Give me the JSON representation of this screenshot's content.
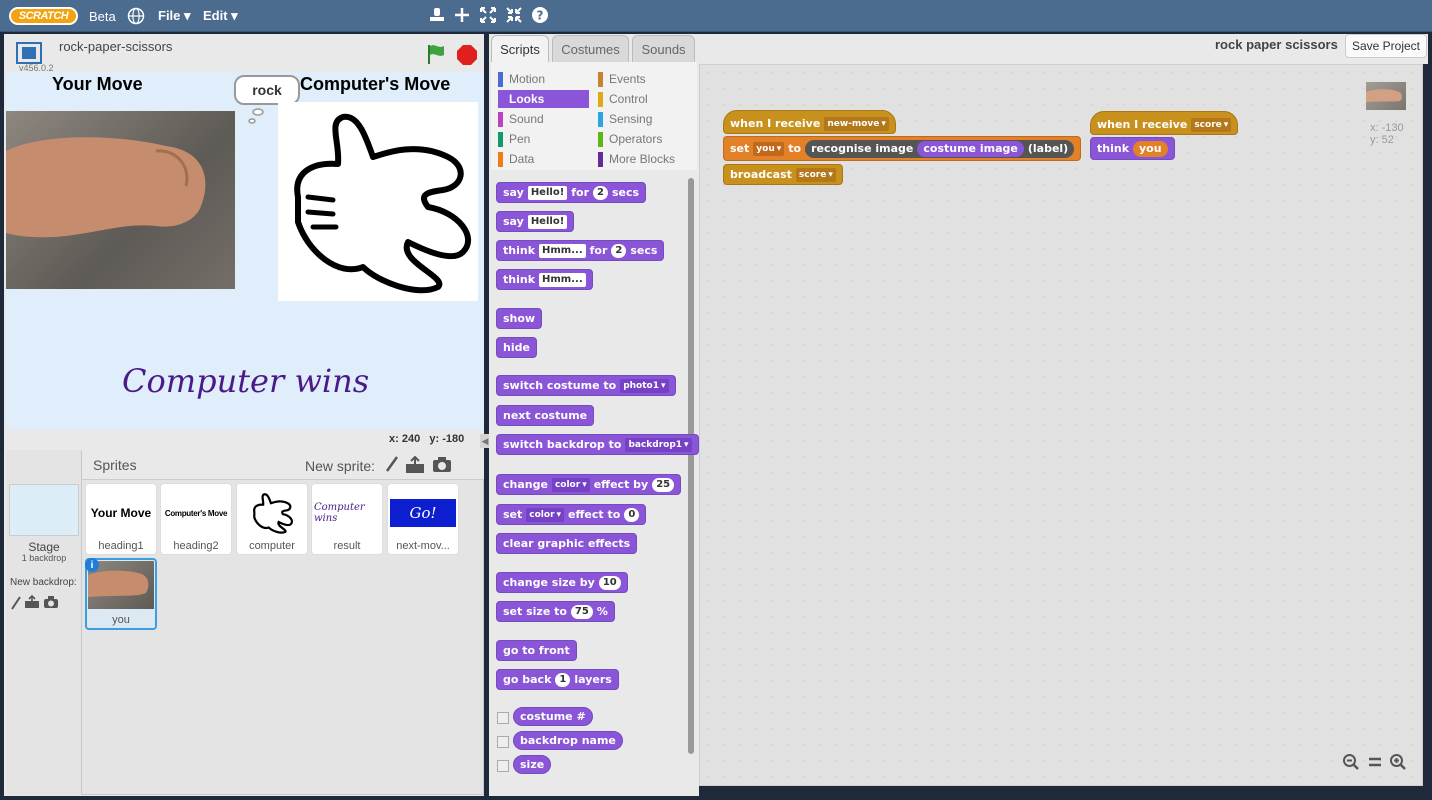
{
  "menubar": {
    "logo": "SCRATCH",
    "beta": "Beta",
    "file": "File",
    "edit": "Edit"
  },
  "project": {
    "name": "rock-paper-scissors",
    "version": "v456.0.2",
    "title": "rock paper scissors",
    "save": "Save Project"
  },
  "stage": {
    "your_move": "Your Move",
    "computers_move": "Computer's Move",
    "bubble": "rock",
    "result": "Computer wins",
    "x_label": "x:",
    "x_val": "240",
    "y_label": "y:",
    "y_val": "-180"
  },
  "sprites_pane": {
    "title": "Sprites",
    "new_sprite": "New sprite:",
    "stage_label": "Stage",
    "stage_sub": "1 backdrop",
    "new_backdrop": "New backdrop:",
    "items": [
      {
        "name": "heading1",
        "thumb": "Your Move"
      },
      {
        "name": "heading2",
        "thumb": "Computer's Move"
      },
      {
        "name": "computer",
        "thumb": ""
      },
      {
        "name": "result",
        "thumb": "Computer wins"
      },
      {
        "name": "next-mov...",
        "thumb": "Go!"
      },
      {
        "name": "you",
        "thumb": ""
      }
    ]
  },
  "tabs": {
    "scripts": "Scripts",
    "costumes": "Costumes",
    "sounds": "Sounds"
  },
  "categories": {
    "motion": "Motion",
    "looks": "Looks",
    "sound": "Sound",
    "pen": "Pen",
    "data": "Data",
    "events": "Events",
    "control": "Control",
    "sensing": "Sensing",
    "operators": "Operators",
    "more": "More Blocks"
  },
  "palette": {
    "say": "say",
    "hello": "Hello!",
    "for": "for",
    "two": "2",
    "secs": "secs",
    "think": "think",
    "hmm": "Hmm...",
    "show": "show",
    "hide": "hide",
    "switch_costume": "switch costume to",
    "photo1": "photo1",
    "next_costume": "next costume",
    "switch_backdrop": "switch backdrop to",
    "backdrop1": "backdrop1",
    "change": "change",
    "color": "color",
    "effect_by": "effect by",
    "twentyfive": "25",
    "set": "set",
    "effect_to": "effect to",
    "zero": "0",
    "clear": "clear graphic effects",
    "change_size": "change size by",
    "ten": "10",
    "set_size": "set size to",
    "seventyfive": "75",
    "pct": "%",
    "go_front": "go to front",
    "go_back": "go back",
    "one": "1",
    "layers": "layers",
    "costume_num": "costume #",
    "backdrop_name": "backdrop name",
    "size": "size"
  },
  "scripts": {
    "when_receive": "when I receive",
    "new_move": "new-move",
    "set": "set",
    "you": "you",
    "to": "to",
    "recognise": "recognise image",
    "costume_image": "costume image",
    "label": "(label)",
    "broadcast": "broadcast",
    "score": "score",
    "think": "think",
    "sprite_x": "x: -130",
    "sprite_y": "y: 52"
  }
}
